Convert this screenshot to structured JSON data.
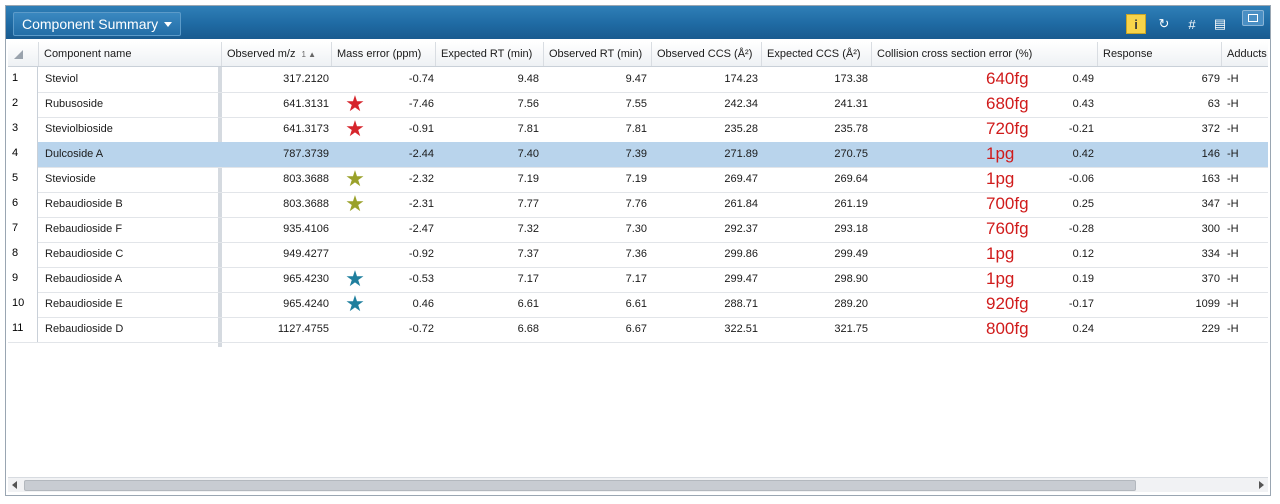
{
  "window": {
    "title": "Component Summary"
  },
  "toolbar": {
    "icons": [
      "info-icon",
      "refresh-icon",
      "hash-icon",
      "export-icon"
    ]
  },
  "columns": [
    "Component name",
    "Observed m/z",
    "Mass error (ppm)",
    "Expected RT (min)",
    "Observed RT (min)",
    "Observed CCS (Å²)",
    "Expected CCS (Å²)",
    "Collision cross section error (%)",
    "Response",
    "Adducts"
  ],
  "rows": [
    {
      "n": "1",
      "name": "Steviol",
      "mz": "317.2120",
      "err": "-0.74",
      "ert": "9.48",
      "ort": "9.47",
      "occs": "174.23",
      "eccs": "173.38",
      "amount": "640fg",
      "ccserr": "0.49",
      "resp": "679",
      "add": "-H",
      "star": ""
    },
    {
      "n": "2",
      "name": "Rubusoside",
      "mz": "641.3131",
      "err": "-7.46",
      "ert": "7.56",
      "ort": "7.55",
      "occs": "242.34",
      "eccs": "241.31",
      "amount": "680fg",
      "ccserr": "0.43",
      "resp": "63",
      "add": "-H",
      "star": "red"
    },
    {
      "n": "3",
      "name": "Steviolbioside",
      "mz": "641.3173",
      "err": "-0.91",
      "ert": "7.81",
      "ort": "7.81",
      "occs": "235.28",
      "eccs": "235.78",
      "amount": "720fg",
      "ccserr": "-0.21",
      "resp": "372",
      "add": "-H",
      "star": "red"
    },
    {
      "n": "4",
      "name": "Dulcoside A",
      "mz": "787.3739",
      "err": "-2.44",
      "ert": "7.40",
      "ort": "7.39",
      "occs": "271.89",
      "eccs": "270.75",
      "amount": "1pg",
      "ccserr": "0.42",
      "resp": "146",
      "add": "-H",
      "star": ""
    },
    {
      "n": "5",
      "name": "Stevioside",
      "mz": "803.3688",
      "err": "-2.32",
      "ert": "7.19",
      "ort": "7.19",
      "occs": "269.47",
      "eccs": "269.64",
      "amount": "1pg",
      "ccserr": "-0.06",
      "resp": "163",
      "add": "-H",
      "star": "olive"
    },
    {
      "n": "6",
      "name": "Rebaudioside  B",
      "mz": "803.3688",
      "err": "-2.31",
      "ert": "7.77",
      "ort": "7.76",
      "occs": "261.84",
      "eccs": "261.19",
      "amount": "700fg",
      "ccserr": "0.25",
      "resp": "347",
      "add": "-H",
      "star": "olive"
    },
    {
      "n": "7",
      "name": "Rebaudioside  F",
      "mz": "935.4106",
      "err": "-2.47",
      "ert": "7.32",
      "ort": "7.30",
      "occs": "292.37",
      "eccs": "293.18",
      "amount": "760fg",
      "ccserr": "-0.28",
      "resp": "300",
      "add": "-H",
      "star": ""
    },
    {
      "n": "8",
      "name": "Rebaudioside  C",
      "mz": "949.4277",
      "err": "-0.92",
      "ert": "7.37",
      "ort": "7.36",
      "occs": "299.86",
      "eccs": "299.49",
      "amount": "1pg",
      "ccserr": "0.12",
      "resp": "334",
      "add": "-H",
      "star": ""
    },
    {
      "n": "9",
      "name": "Rebaudioside  A",
      "mz": "965.4230",
      "err": "-0.53",
      "ert": "7.17",
      "ort": "7.17",
      "occs": "299.47",
      "eccs": "298.90",
      "amount": "1pg",
      "ccserr": "0.19",
      "resp": "370",
      "add": "-H",
      "star": "teal"
    },
    {
      "n": "10",
      "name": "Rebaudioside  E",
      "mz": "965.4240",
      "err": "0.46",
      "ert": "6.61",
      "ort": "6.61",
      "occs": "288.71",
      "eccs": "289.20",
      "amount": "920fg",
      "ccserr": "-0.17",
      "resp": "1099",
      "add": "-H",
      "star": "teal"
    },
    {
      "n": "11",
      "name": "Rebaudioside  D",
      "mz": "1127.4755",
      "err": "-0.72",
      "ert": "6.68",
      "ort": "6.67",
      "occs": "322.51",
      "eccs": "321.75",
      "amount": "800fg",
      "ccserr": "0.24",
      "resp": "229",
      "add": "-H",
      "star": ""
    }
  ],
  "selected_row": "4",
  "colors": {
    "titlebar": "#1f6aa3",
    "selected_row": "#b9d4ec",
    "amount_text": "#d01b1b",
    "star_red": "#d6252c",
    "star_olive": "#9aa12a",
    "star_teal": "#1f7f9e"
  }
}
